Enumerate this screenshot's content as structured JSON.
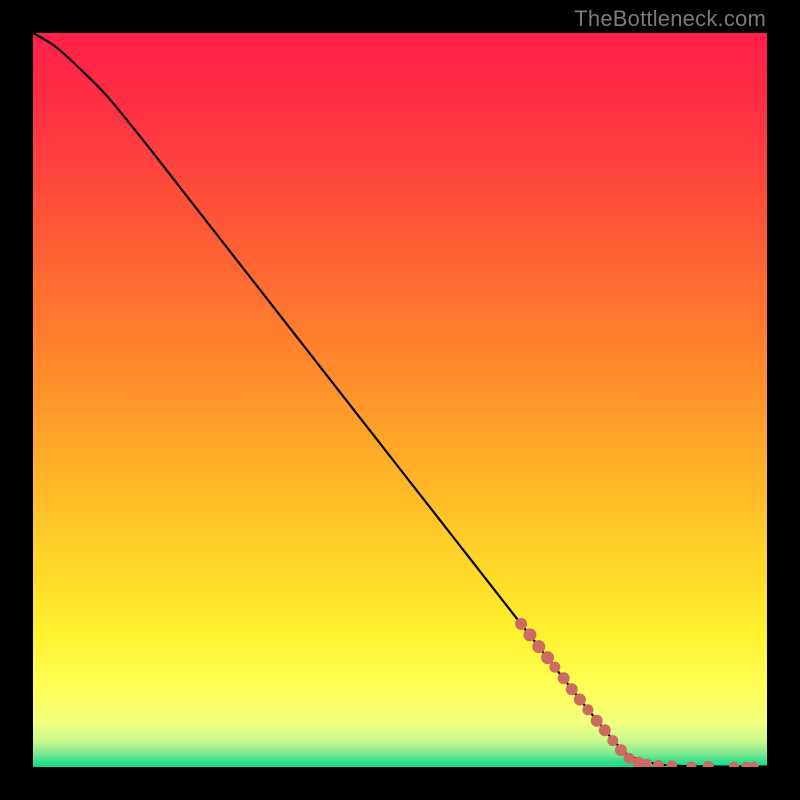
{
  "watermark": "TheBottleneck.com",
  "chart_data": {
    "type": "line",
    "title": "",
    "xlabel": "",
    "ylabel": "",
    "xlim": [
      0,
      100
    ],
    "ylim": [
      0,
      100
    ],
    "series": [
      {
        "name": "curve",
        "x": [
          0,
          3,
          6,
          10,
          15,
          20,
          25,
          30,
          35,
          40,
          45,
          50,
          55,
          60,
          65,
          70,
          75,
          80,
          82,
          85,
          88,
          92,
          96,
          100
        ],
        "y": [
          100,
          98.2,
          95.5,
          91.5,
          85.4,
          79.0,
          72.6,
          66.2,
          59.8,
          53.4,
          47.0,
          40.6,
          34.2,
          27.8,
          21.4,
          15.0,
          8.6,
          2.6,
          1.2,
          0.4,
          0.15,
          0.08,
          0.05,
          0.05
        ]
      }
    ],
    "markers": {
      "name": "highlight-points",
      "color": "#cc6b61",
      "points": [
        {
          "x": 66.5,
          "y": 19.5,
          "r": 6
        },
        {
          "x": 67.7,
          "y": 18.0,
          "r": 6.5
        },
        {
          "x": 68.9,
          "y": 16.4,
          "r": 6.5
        },
        {
          "x": 70.1,
          "y": 14.9,
          "r": 6.5
        },
        {
          "x": 71.1,
          "y": 13.6,
          "r": 5.5
        },
        {
          "x": 72.3,
          "y": 12.1,
          "r": 6
        },
        {
          "x": 73.4,
          "y": 10.6,
          "r": 6
        },
        {
          "x": 74.5,
          "y": 9.2,
          "r": 6
        },
        {
          "x": 75.6,
          "y": 7.8,
          "r": 5.5
        },
        {
          "x": 76.8,
          "y": 6.3,
          "r": 6
        },
        {
          "x": 77.9,
          "y": 5.0,
          "r": 6
        },
        {
          "x": 79.0,
          "y": 3.6,
          "r": 5.5
        },
        {
          "x": 80.1,
          "y": 2.3,
          "r": 6
        },
        {
          "x": 81.2,
          "y": 1.2,
          "r": 5.5
        },
        {
          "x": 82.5,
          "y": 0.6,
          "r": 6
        },
        {
          "x": 83.6,
          "y": 0.35,
          "r": 5.5
        },
        {
          "x": 85.2,
          "y": 0.22,
          "r": 5.5
        },
        {
          "x": 87.0,
          "y": 0.15,
          "r": 5.5
        },
        {
          "x": 89.7,
          "y": 0.1,
          "r": 5
        },
        {
          "x": 92.0,
          "y": 0.08,
          "r": 5.5
        },
        {
          "x": 95.5,
          "y": 0.06,
          "r": 5
        },
        {
          "x": 97.2,
          "y": 0.05,
          "r": 5
        },
        {
          "x": 98.2,
          "y": 0.05,
          "r": 5
        }
      ]
    },
    "gradient_stops": [
      {
        "offset": 0.0,
        "color": "#ff1f4a"
      },
      {
        "offset": 0.1,
        "color": "#ff2f44"
      },
      {
        "offset": 0.22,
        "color": "#ff4c3a"
      },
      {
        "offset": 0.35,
        "color": "#ff6e31"
      },
      {
        "offset": 0.48,
        "color": "#ff902b"
      },
      {
        "offset": 0.6,
        "color": "#ffb327"
      },
      {
        "offset": 0.72,
        "color": "#ffd528"
      },
      {
        "offset": 0.82,
        "color": "#fff22f"
      },
      {
        "offset": 0.89,
        "color": "#ffff55"
      },
      {
        "offset": 0.94,
        "color": "#f3ff7e"
      },
      {
        "offset": 0.965,
        "color": "#c7f88c"
      },
      {
        "offset": 0.982,
        "color": "#7de990"
      },
      {
        "offset": 0.993,
        "color": "#2fe08e"
      },
      {
        "offset": 1.0,
        "color": "#0edb86"
      }
    ]
  }
}
